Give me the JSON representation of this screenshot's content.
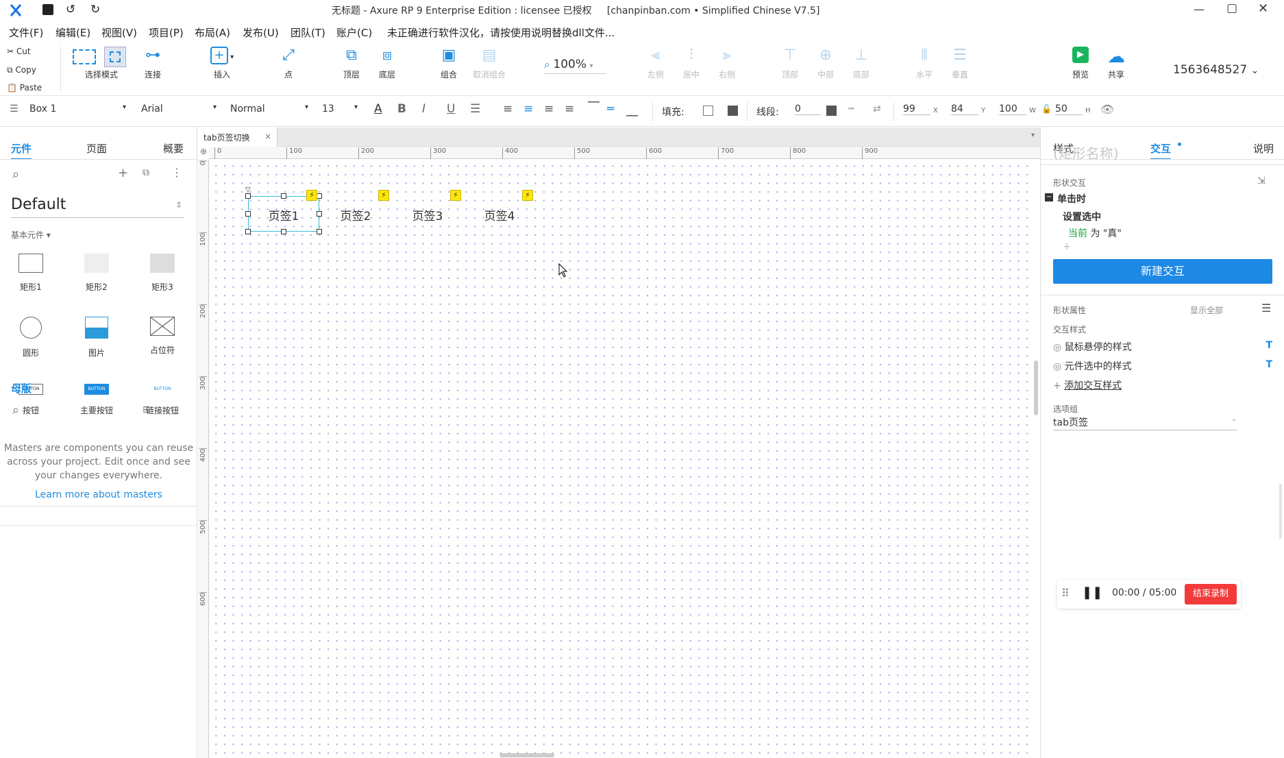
{
  "window": {
    "title": "无标题 - Axure RP 9 Enterprise Edition : licensee 已授权     [chanpinban.com • Simplified Chinese V7.5]"
  },
  "menu": {
    "items": [
      "文件(F)",
      "编辑(E)",
      "视图(V)",
      "项目(P)",
      "布局(A)",
      "发布(U)",
      "团队(T)",
      "账户(C)"
    ],
    "notice": "未正确进行软件汉化，请按使用说明替换dll文件..."
  },
  "clipboard": {
    "cut": "Cut",
    "copy": "Copy",
    "paste": "Paste"
  },
  "toolbar": {
    "select_mode": "选择模式",
    "connect": "连接",
    "insert": "插入",
    "point": "点",
    "top_layer": "顶层",
    "bottom_layer": "底层",
    "group": "组合",
    "ungroup": "取消组合",
    "zoom": "100%",
    "align_left": "左侧",
    "align_center": "居中",
    "align_right": "右侧",
    "align_top": "顶部",
    "align_middle": "中部",
    "align_bottom": "底部",
    "dist_h": "水平",
    "dist_v": "垂直",
    "preview": "预览",
    "share": "共享",
    "account": "1563648527"
  },
  "format": {
    "style_name": "Box 1",
    "font": "Arial",
    "weight": "Normal",
    "size": "13",
    "fill_label": "填充:",
    "line_label": "线段:",
    "line_value": "0",
    "x": "99",
    "x_label": "X",
    "y": "84",
    "y_label": "Y",
    "w": "100",
    "w_label": "W",
    "h": "50",
    "h_label": "H"
  },
  "left": {
    "tabs": [
      "元件",
      "页面",
      "概要"
    ],
    "library": "Default",
    "section": "基本元件 ▾",
    "widgets": [
      "矩形1",
      "矩形2",
      "矩形3",
      "圆形",
      "图片",
      "占位符",
      "按钮",
      "主要按钮",
      "链接按钮"
    ],
    "button_text": "BUTTON",
    "masters_title": "母版",
    "masters_text": "Masters are components you can reuse across your project. Edit once and see your changes everywhere.",
    "masters_link": "Learn more about masters"
  },
  "canvas": {
    "tab_name": "tab页签切换",
    "ruler_h": [
      "0",
      "100",
      "200",
      "300",
      "400",
      "500",
      "600",
      "700",
      "800",
      "900"
    ],
    "ruler_v": [
      "0",
      "100",
      "200",
      "300",
      "400",
      "500",
      "600"
    ],
    "tabs": [
      "页签1",
      "页签2",
      "页签3",
      "页签4"
    ]
  },
  "right": {
    "tabs": [
      "样式",
      "交互",
      "说明"
    ],
    "shape_name_placeholder": "(矩形名称)",
    "shape_interaction": "形状交互",
    "event": "单击时",
    "action": "设置选中",
    "target_current": "当前",
    "target_rest": " 为 \"真\"",
    "new_interaction": "新建交互",
    "shape_props": "形状属性",
    "show_all": "显示全部",
    "interaction_styles": "交互样式",
    "hover_style": "鼠标悬停的样式",
    "selected_style": "元件选中的样式",
    "add_style": "添加交互样式",
    "option_group_label": "选项组",
    "option_group_value": "tab页签",
    "t_mark": "T"
  },
  "recorder": {
    "time": "00:00 / 05:00",
    "stop": "结束录制"
  },
  "colors": {
    "accent": "#1d8ce0",
    "primary_btn": "#1e88e5",
    "record": "#f23a3a",
    "selection": "#3ab8d8",
    "bolt": "#ffe60a"
  }
}
